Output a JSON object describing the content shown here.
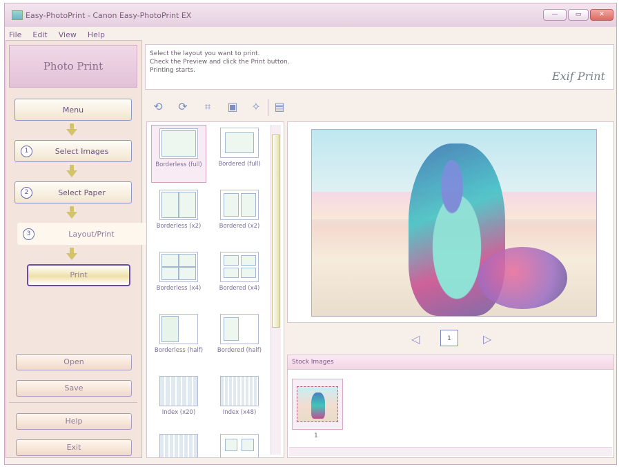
{
  "window": {
    "title": "Easy-PhotoPrint - Canon Easy-PhotoPrint EX",
    "controls": [
      "minimize",
      "maximize",
      "close"
    ]
  },
  "menu": [
    "File",
    "Edit",
    "View",
    "Help"
  ],
  "sidebar": {
    "header": "Photo Print",
    "steps": [
      {
        "label": "Menu"
      },
      {
        "num": "1",
        "label": "Select Images"
      },
      {
        "num": "2",
        "label": "Select Paper"
      },
      {
        "num": "3",
        "label": "Layout/Print"
      }
    ],
    "print_label": "Print",
    "open_label": "Open",
    "save_label": "Save",
    "help_label": "Help",
    "exit_label": "Exit"
  },
  "instructions": {
    "line1": "Select the layout you want to print.",
    "line2": "Check the Preview and click the Print button.",
    "line3": "Printing starts.",
    "logo": "Exif Print"
  },
  "toolbar": {
    "icons": [
      "rotate-left-icon",
      "rotate-right-icon",
      "crop-icon",
      "frame-icon",
      "correct-image-icon",
      "date-settings-icon"
    ]
  },
  "layouts": [
    {
      "label": "Borderless (full)",
      "selected": true
    },
    {
      "label": "Bordered (full)"
    },
    {
      "label": "Borderless (x2)"
    },
    {
      "label": "Bordered (x2)"
    },
    {
      "label": "Borderless (x4)"
    },
    {
      "label": "Bordered (x4)"
    },
    {
      "label": "Borderless (half)"
    },
    {
      "label": "Bordered (half)"
    },
    {
      "label": "Index (x20)"
    },
    {
      "label": "Index (x48)"
    }
  ],
  "preview": {
    "page_number": "1",
    "prev_icon": "prev-page-icon",
    "next_icon": "next-page-icon"
  },
  "stock": {
    "header": "Stock Images",
    "items": [
      {
        "count": "1"
      }
    ]
  }
}
